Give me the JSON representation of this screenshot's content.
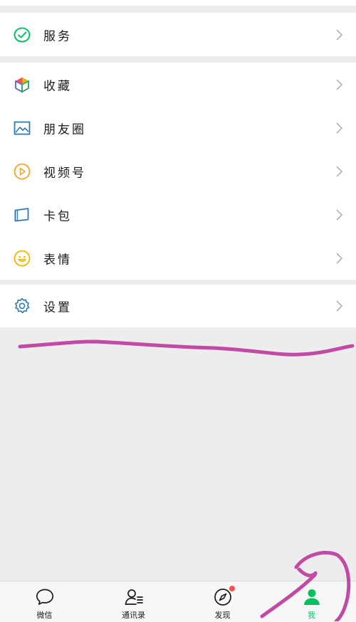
{
  "colors": {
    "background": "#ededed",
    "card": "#ffffff",
    "accent_green": "#07c160",
    "badge_red": "#fa5151",
    "annotation_pen": "#c04aa4"
  },
  "menu": {
    "services": {
      "label": "服务",
      "icon": "service-icon"
    },
    "favorites": {
      "label": "收藏",
      "icon": "cube-icon"
    },
    "moments": {
      "label": "朋友圈",
      "icon": "image-icon"
    },
    "channels": {
      "label": "视频号",
      "icon": "play-icon"
    },
    "cards": {
      "label": "卡包",
      "icon": "wallet-icon"
    },
    "stickers": {
      "label": "表情",
      "icon": "smiley-icon"
    },
    "settings": {
      "label": "设置",
      "icon": "gear-icon"
    }
  },
  "tabbar": {
    "tabs": [
      {
        "label": "微信",
        "icon": "chat-bubble-icon",
        "active": false
      },
      {
        "label": "通讯录",
        "icon": "contacts-icon",
        "active": false
      },
      {
        "label": "发现",
        "icon": "compass-icon",
        "active": false,
        "badge": true
      },
      {
        "label": "我",
        "icon": "person-icon",
        "active": true
      }
    ]
  }
}
